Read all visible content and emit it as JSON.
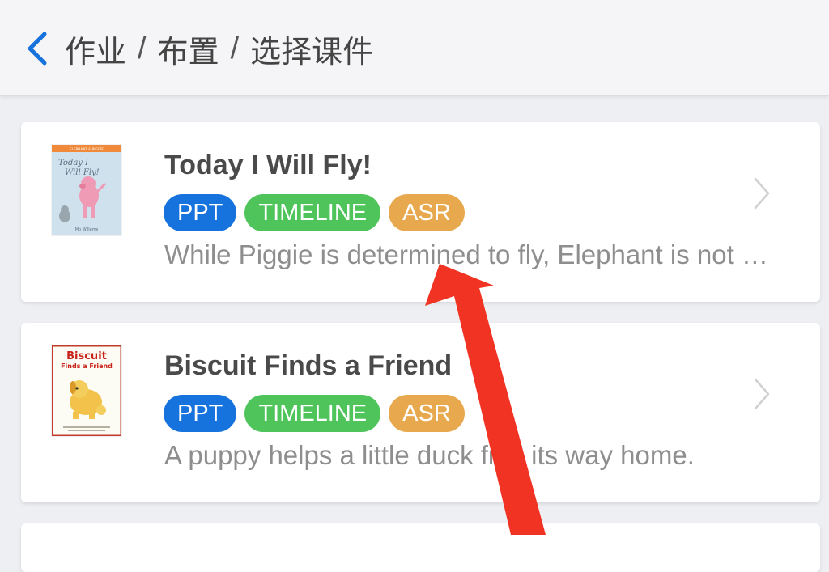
{
  "header": {
    "back_icon": "chevron-left-icon",
    "crumbs": [
      "作业",
      "布置",
      "选择课件"
    ],
    "separator": "/",
    "accent_color": "#1672dd"
  },
  "courses": [
    {
      "title": "Today I Will Fly!",
      "tags": [
        "PPT",
        "TIMELINE",
        "ASR"
      ],
      "description": "While Piggie is determined to fly, Elephant is not so sure.",
      "cover": {
        "series": "ELEPHANT & PIGGIE",
        "title_line1": "Today I",
        "title_line2": "Will Fly!",
        "author": "Mo Willems"
      }
    },
    {
      "title": "Biscuit Finds a Friend",
      "tags": [
        "PPT",
        "TIMELINE",
        "ASR"
      ],
      "description": "A puppy helps a little duck find its way home.",
      "cover": {
        "title_line1": "Biscuit",
        "title_line2": "Finds a Friend"
      }
    }
  ],
  "tag_colors": {
    "PPT": "#1672dd",
    "TIMELINE": "#4ec45b",
    "ASR": "#e8a94e"
  },
  "annotation": {
    "type": "arrow",
    "color": "#f03323",
    "points_to": "ASR tag"
  }
}
